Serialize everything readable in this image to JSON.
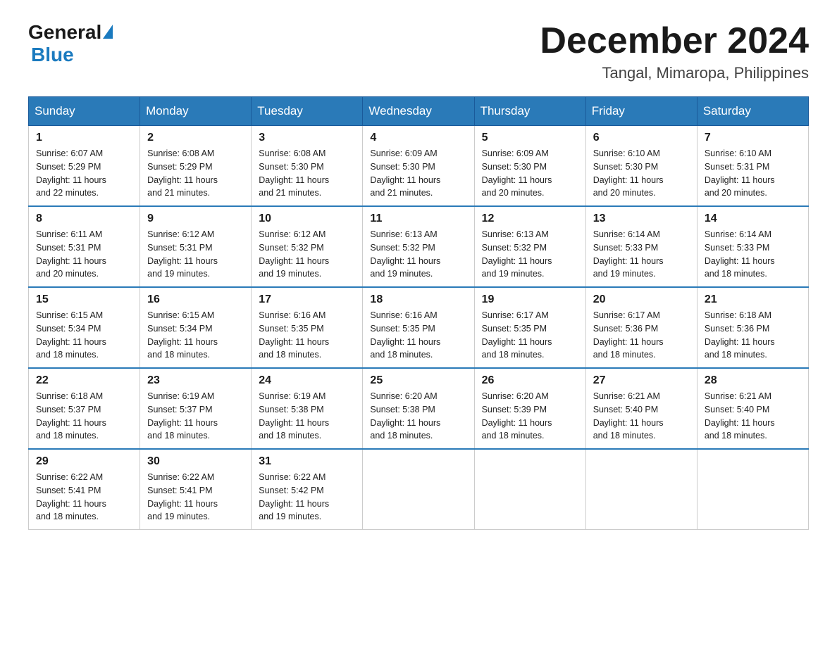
{
  "header": {
    "logo_general": "General",
    "logo_blue": "Blue",
    "month_year": "December 2024",
    "location": "Tangal, Mimaropa, Philippines"
  },
  "days_of_week": [
    "Sunday",
    "Monday",
    "Tuesday",
    "Wednesday",
    "Thursday",
    "Friday",
    "Saturday"
  ],
  "weeks": [
    [
      {
        "date": "1",
        "sunrise": "6:07 AM",
        "sunset": "5:29 PM",
        "daylight": "11 hours and 22 minutes."
      },
      {
        "date": "2",
        "sunrise": "6:08 AM",
        "sunset": "5:29 PM",
        "daylight": "11 hours and 21 minutes."
      },
      {
        "date": "3",
        "sunrise": "6:08 AM",
        "sunset": "5:30 PM",
        "daylight": "11 hours and 21 minutes."
      },
      {
        "date": "4",
        "sunrise": "6:09 AM",
        "sunset": "5:30 PM",
        "daylight": "11 hours and 21 minutes."
      },
      {
        "date": "5",
        "sunrise": "6:09 AM",
        "sunset": "5:30 PM",
        "daylight": "11 hours and 20 minutes."
      },
      {
        "date": "6",
        "sunrise": "6:10 AM",
        "sunset": "5:30 PM",
        "daylight": "11 hours and 20 minutes."
      },
      {
        "date": "7",
        "sunrise": "6:10 AM",
        "sunset": "5:31 PM",
        "daylight": "11 hours and 20 minutes."
      }
    ],
    [
      {
        "date": "8",
        "sunrise": "6:11 AM",
        "sunset": "5:31 PM",
        "daylight": "11 hours and 20 minutes."
      },
      {
        "date": "9",
        "sunrise": "6:12 AM",
        "sunset": "5:31 PM",
        "daylight": "11 hours and 19 minutes."
      },
      {
        "date": "10",
        "sunrise": "6:12 AM",
        "sunset": "5:32 PM",
        "daylight": "11 hours and 19 minutes."
      },
      {
        "date": "11",
        "sunrise": "6:13 AM",
        "sunset": "5:32 PM",
        "daylight": "11 hours and 19 minutes."
      },
      {
        "date": "12",
        "sunrise": "6:13 AM",
        "sunset": "5:32 PM",
        "daylight": "11 hours and 19 minutes."
      },
      {
        "date": "13",
        "sunrise": "6:14 AM",
        "sunset": "5:33 PM",
        "daylight": "11 hours and 19 minutes."
      },
      {
        "date": "14",
        "sunrise": "6:14 AM",
        "sunset": "5:33 PM",
        "daylight": "11 hours and 18 minutes."
      }
    ],
    [
      {
        "date": "15",
        "sunrise": "6:15 AM",
        "sunset": "5:34 PM",
        "daylight": "11 hours and 18 minutes."
      },
      {
        "date": "16",
        "sunrise": "6:15 AM",
        "sunset": "5:34 PM",
        "daylight": "11 hours and 18 minutes."
      },
      {
        "date": "17",
        "sunrise": "6:16 AM",
        "sunset": "5:35 PM",
        "daylight": "11 hours and 18 minutes."
      },
      {
        "date": "18",
        "sunrise": "6:16 AM",
        "sunset": "5:35 PM",
        "daylight": "11 hours and 18 minutes."
      },
      {
        "date": "19",
        "sunrise": "6:17 AM",
        "sunset": "5:35 PM",
        "daylight": "11 hours and 18 minutes."
      },
      {
        "date": "20",
        "sunrise": "6:17 AM",
        "sunset": "5:36 PM",
        "daylight": "11 hours and 18 minutes."
      },
      {
        "date": "21",
        "sunrise": "6:18 AM",
        "sunset": "5:36 PM",
        "daylight": "11 hours and 18 minutes."
      }
    ],
    [
      {
        "date": "22",
        "sunrise": "6:18 AM",
        "sunset": "5:37 PM",
        "daylight": "11 hours and 18 minutes."
      },
      {
        "date": "23",
        "sunrise": "6:19 AM",
        "sunset": "5:37 PM",
        "daylight": "11 hours and 18 minutes."
      },
      {
        "date": "24",
        "sunrise": "6:19 AM",
        "sunset": "5:38 PM",
        "daylight": "11 hours and 18 minutes."
      },
      {
        "date": "25",
        "sunrise": "6:20 AM",
        "sunset": "5:38 PM",
        "daylight": "11 hours and 18 minutes."
      },
      {
        "date": "26",
        "sunrise": "6:20 AM",
        "sunset": "5:39 PM",
        "daylight": "11 hours and 18 minutes."
      },
      {
        "date": "27",
        "sunrise": "6:21 AM",
        "sunset": "5:40 PM",
        "daylight": "11 hours and 18 minutes."
      },
      {
        "date": "28",
        "sunrise": "6:21 AM",
        "sunset": "5:40 PM",
        "daylight": "11 hours and 18 minutes."
      }
    ],
    [
      {
        "date": "29",
        "sunrise": "6:22 AM",
        "sunset": "5:41 PM",
        "daylight": "11 hours and 18 minutes."
      },
      {
        "date": "30",
        "sunrise": "6:22 AM",
        "sunset": "5:41 PM",
        "daylight": "11 hours and 19 minutes."
      },
      {
        "date": "31",
        "sunrise": "6:22 AM",
        "sunset": "5:42 PM",
        "daylight": "11 hours and 19 minutes."
      },
      null,
      null,
      null,
      null
    ]
  ]
}
